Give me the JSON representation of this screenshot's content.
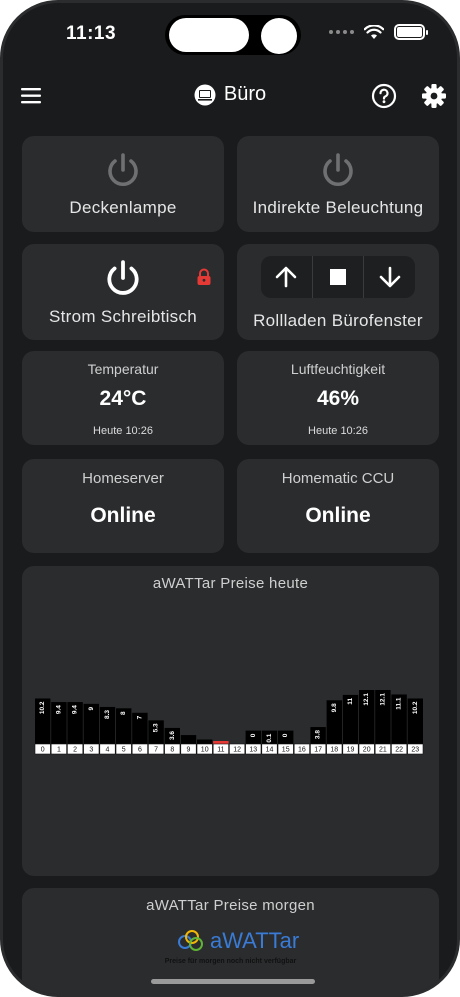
{
  "status_bar": {
    "time": "11:13"
  },
  "header": {
    "title": "Büro"
  },
  "tiles": {
    "deckenlampe": {
      "label": "Deckenlampe"
    },
    "indirekte": {
      "label": "Indirekte Beleuchtung"
    },
    "strom": {
      "label": "Strom Schreibtisch"
    },
    "rollladen": {
      "label": "Rollladen Bürofenster"
    }
  },
  "sensors": {
    "temperatur": {
      "title": "Temperatur",
      "value": "24°C",
      "time": "Heute 10:26"
    },
    "luftfeuchtigkeit": {
      "title": "Luftfeuchtigkeit",
      "value": "46%",
      "time": "Heute 10:26"
    }
  },
  "servers": {
    "homeserver": {
      "title": "Homeserver",
      "status": "Online"
    },
    "homematic": {
      "title": "Homematic CCU",
      "status": "Online"
    }
  },
  "chart_today": {
    "title": "aWATTar Preise heute"
  },
  "chart_data": {
    "type": "bar",
    "categories": [
      "0",
      "1",
      "2",
      "3",
      "4",
      "5",
      "6",
      "7",
      "8",
      "9",
      "10",
      "11",
      "12",
      "13",
      "14",
      "15",
      "16",
      "17",
      "18",
      "19",
      "20",
      "21",
      "22",
      "23"
    ],
    "values": [
      10.2,
      9.4,
      9.4,
      9,
      8.3,
      8,
      7,
      5.3,
      3.6,
      2,
      1,
      0.5,
      0,
      3,
      3,
      3,
      0,
      3.8,
      9.8,
      11,
      12.1,
      12.1,
      11.1,
      10.2
    ],
    "labels": [
      "10.2",
      "9.4",
      "9.4",
      "9",
      "8.3",
      "8",
      "7",
      "5.3",
      "3.6",
      "",
      "",
      "",
      "",
      "0",
      "0.1",
      "0",
      "",
      "3.8",
      "9.8",
      "11",
      "12.1",
      "12.1",
      "11.1",
      "10.2"
    ],
    "highlight_index": 11,
    "highlight_color": "#e53935",
    "bar_color": "#000000",
    "ylim": [
      0,
      13
    ]
  },
  "chart_tomorrow": {
    "title": "aWATTar Preise morgen",
    "logo": "aWATTar",
    "note": "Preise für morgen noch nicht verfügbar"
  },
  "colors": {
    "background": "#1a1b1c",
    "card": "#2a2c2e",
    "accent_red": "#e53935"
  }
}
